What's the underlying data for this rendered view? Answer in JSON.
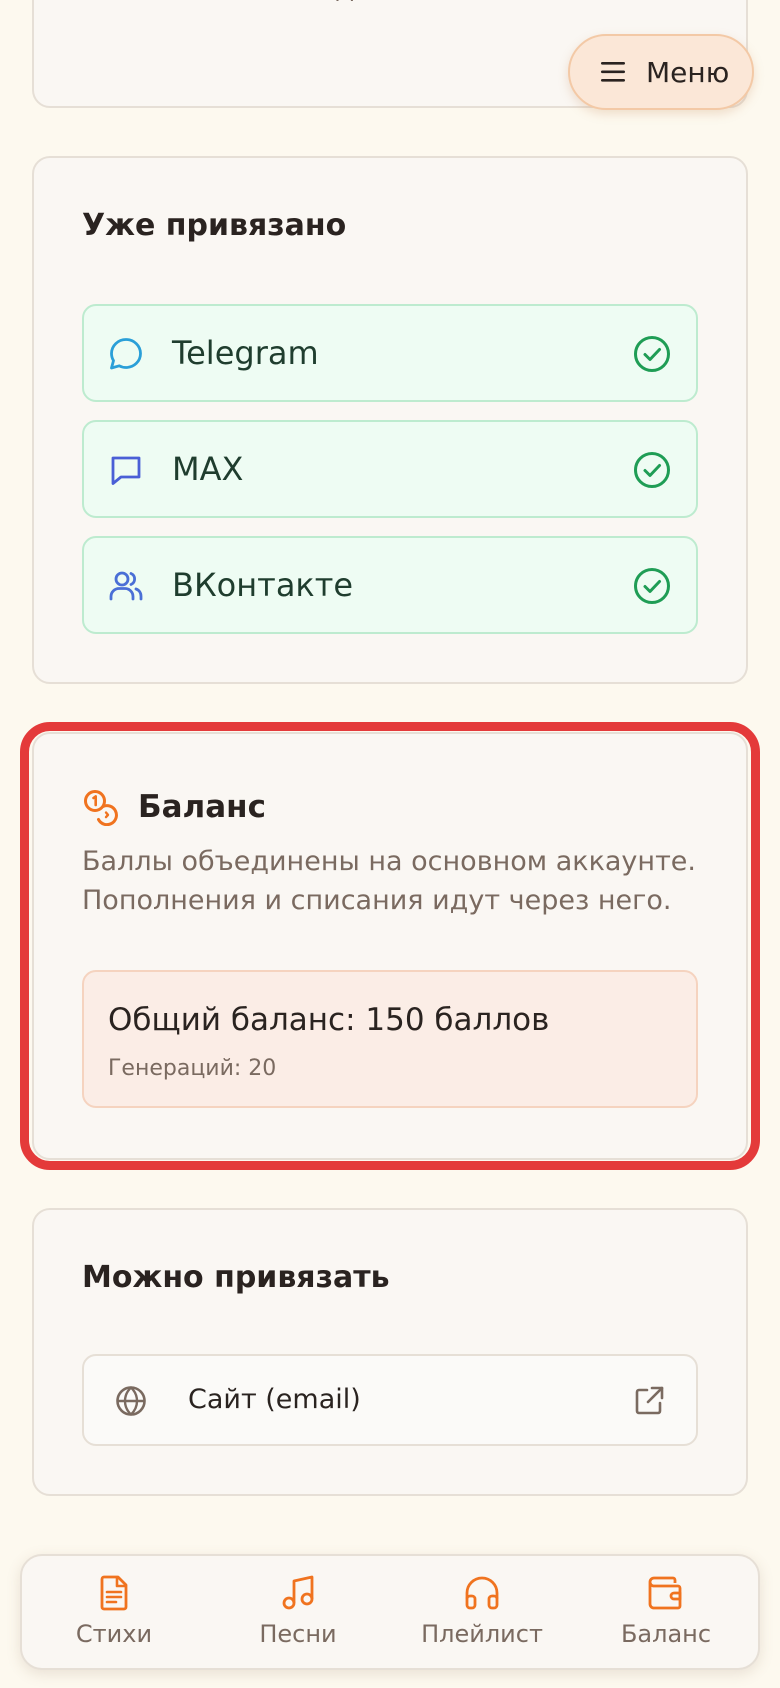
{
  "top_card": {
    "trailing_text": "канале отдельно."
  },
  "menu": {
    "label": "Меню"
  },
  "linked": {
    "title": "Уже привязано",
    "items": [
      {
        "label": "Telegram",
        "icon": "chat-bubble-icon",
        "icon_color": "#2a9fd8"
      },
      {
        "label": "MAX",
        "icon": "message-square-icon",
        "icon_color": "#4a5fd6"
      },
      {
        "label": "ВКонтакте",
        "icon": "users-icon",
        "icon_color": "#4a6fd6"
      }
    ],
    "check_color": "#1f9d55"
  },
  "balance": {
    "title": "Баланс",
    "description": "Баллы объединены на основном аккаунте. Пополнения и списания идут через него.",
    "total": "Общий баланс: 150 баллов",
    "generations": "Генераций: 20",
    "icon": "coins-icon",
    "accent_color": "#f0731f",
    "highlight_color": "#e43a3a"
  },
  "can_link": {
    "title": "Можно привязать",
    "items": [
      {
        "label": "Сайт (email)",
        "icon": "globe-icon",
        "action_icon": "external-link-icon"
      }
    ]
  },
  "bottom_nav": {
    "accent_color": "#f0731f",
    "items": [
      {
        "label": "Стихи",
        "icon": "document-icon"
      },
      {
        "label": "Песни",
        "icon": "music-note-icon"
      },
      {
        "label": "Плейлист",
        "icon": "headphones-icon"
      },
      {
        "label": "Баланс",
        "icon": "wallet-icon"
      }
    ]
  }
}
